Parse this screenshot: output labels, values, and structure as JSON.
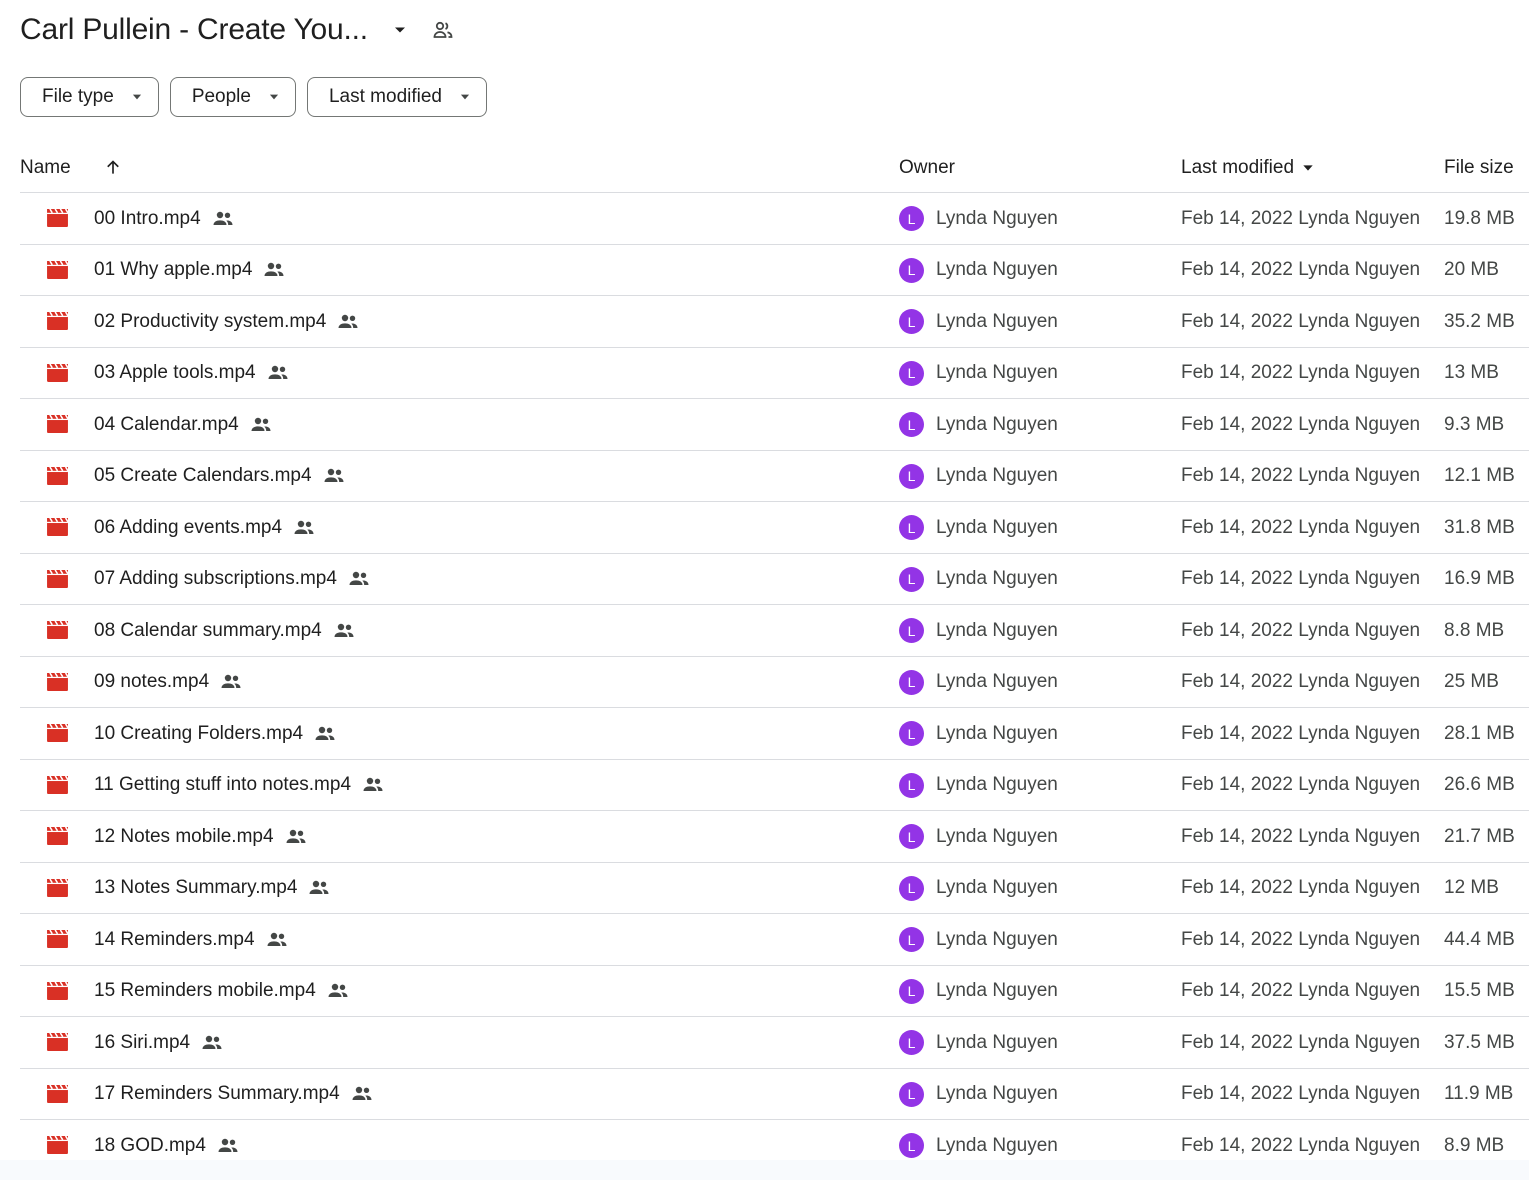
{
  "header": {
    "title": "Carl Pullein - Create You...",
    "caret_icon": "arrow-drop-down-icon",
    "shared_icon": "people-outline-icon"
  },
  "filters": [
    {
      "label": "File type"
    },
    {
      "label": "People"
    },
    {
      "label": "Last modified"
    }
  ],
  "table": {
    "columns": {
      "name": "Name",
      "owner": "Owner",
      "last_modified": "Last modified",
      "file_size": "File size"
    },
    "rows": [
      {
        "name": "00 Intro.mp4",
        "owner": "Lynda Nguyen",
        "avatar": "L",
        "modified": "Feb 14, 2022 Lynda Nguyen",
        "size": "19.8 MB"
      },
      {
        "name": "01 Why apple.mp4",
        "owner": "Lynda Nguyen",
        "avatar": "L",
        "modified": "Feb 14, 2022 Lynda Nguyen",
        "size": "20 MB"
      },
      {
        "name": "02 Productivity system.mp4",
        "owner": "Lynda Nguyen",
        "avatar": "L",
        "modified": "Feb 14, 2022 Lynda Nguyen",
        "size": "35.2 MB"
      },
      {
        "name": "03 Apple tools.mp4",
        "owner": "Lynda Nguyen",
        "avatar": "L",
        "modified": "Feb 14, 2022 Lynda Nguyen",
        "size": "13 MB"
      },
      {
        "name": "04 Calendar.mp4",
        "owner": "Lynda Nguyen",
        "avatar": "L",
        "modified": "Feb 14, 2022 Lynda Nguyen",
        "size": "9.3 MB"
      },
      {
        "name": "05 Create Calendars.mp4",
        "owner": "Lynda Nguyen",
        "avatar": "L",
        "modified": "Feb 14, 2022 Lynda Nguyen",
        "size": "12.1 MB"
      },
      {
        "name": "06 Adding events.mp4",
        "owner": "Lynda Nguyen",
        "avatar": "L",
        "modified": "Feb 14, 2022 Lynda Nguyen",
        "size": "31.8 MB"
      },
      {
        "name": "07 Adding subscriptions.mp4",
        "owner": "Lynda Nguyen",
        "avatar": "L",
        "modified": "Feb 14, 2022 Lynda Nguyen",
        "size": "16.9 MB"
      },
      {
        "name": "08 Calendar summary.mp4",
        "owner": "Lynda Nguyen",
        "avatar": "L",
        "modified": "Feb 14, 2022 Lynda Nguyen",
        "size": "8.8 MB"
      },
      {
        "name": "09 notes.mp4",
        "owner": "Lynda Nguyen",
        "avatar": "L",
        "modified": "Feb 14, 2022 Lynda Nguyen",
        "size": "25 MB"
      },
      {
        "name": "10 Creating Folders.mp4",
        "owner": "Lynda Nguyen",
        "avatar": "L",
        "modified": "Feb 14, 2022 Lynda Nguyen",
        "size": "28.1 MB"
      },
      {
        "name": "11 Getting stuff into notes.mp4",
        "owner": "Lynda Nguyen",
        "avatar": "L",
        "modified": "Feb 14, 2022 Lynda Nguyen",
        "size": "26.6 MB"
      },
      {
        "name": "12 Notes mobile.mp4",
        "owner": "Lynda Nguyen",
        "avatar": "L",
        "modified": "Feb 14, 2022 Lynda Nguyen",
        "size": "21.7 MB"
      },
      {
        "name": "13 Notes Summary.mp4",
        "owner": "Lynda Nguyen",
        "avatar": "L",
        "modified": "Feb 14, 2022 Lynda Nguyen",
        "size": "12 MB"
      },
      {
        "name": "14 Reminders.mp4",
        "owner": "Lynda Nguyen",
        "avatar": "L",
        "modified": "Feb 14, 2022 Lynda Nguyen",
        "size": "44.4 MB"
      },
      {
        "name": "15 Reminders mobile.mp4",
        "owner": "Lynda Nguyen",
        "avatar": "L",
        "modified": "Feb 14, 2022 Lynda Nguyen",
        "size": "15.5 MB"
      },
      {
        "name": "16 Siri.mp4",
        "owner": "Lynda Nguyen",
        "avatar": "L",
        "modified": "Feb 14, 2022 Lynda Nguyen",
        "size": "37.5 MB"
      },
      {
        "name": "17 Reminders Summary.mp4",
        "owner": "Lynda Nguyen",
        "avatar": "L",
        "modified": "Feb 14, 2022 Lynda Nguyen",
        "size": "11.9 MB"
      },
      {
        "name": "18 GOD.mp4",
        "owner": "Lynda Nguyen",
        "avatar": "L",
        "modified": "Feb 14, 2022 Lynda Nguyen",
        "size": "8.9 MB"
      }
    ]
  },
  "colors": {
    "video_icon": "#d93025",
    "avatar": "#9334e6",
    "divider": "#dadce0",
    "text_primary": "#1f1f1f",
    "text_secondary": "#444746"
  }
}
